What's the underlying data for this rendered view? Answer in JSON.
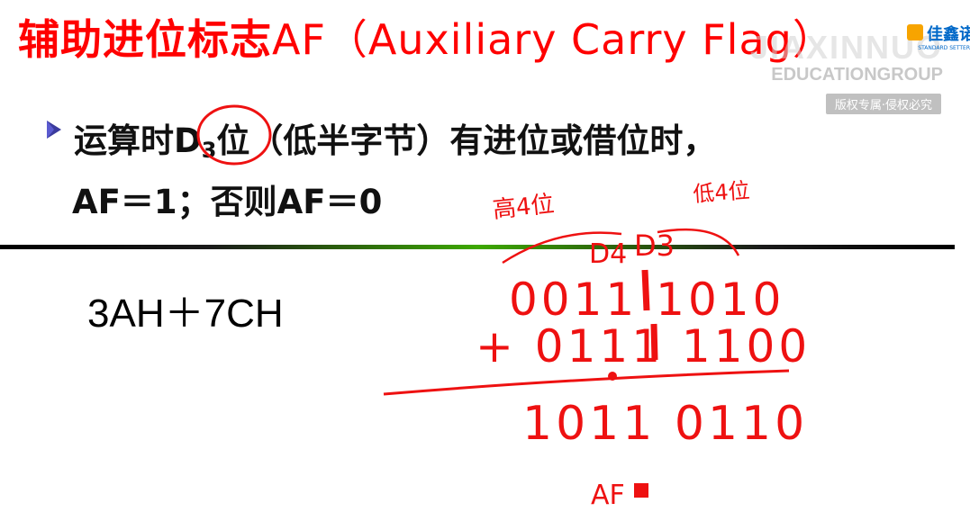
{
  "slide": {
    "title_cn": "辅助进位标志",
    "title_en": "AF（Auxiliary Carry Flag）",
    "watermark": {
      "logo_text": "佳鑫诺",
      "logo_sub": "STANDARD SETTER",
      "line1": "JIAXINNUO",
      "line2": "EDUCATIONGROUP",
      "badge": "版权专属·侵权必究"
    },
    "bullet_icon": "arrow-bullet-icon",
    "rule_line1_prefix": "运算时",
    "rule_line1_d": "D",
    "rule_line1_sub": "3",
    "rule_line1_suffix": "位（低半字节）有进位或借位时，",
    "rule_line2": "AF＝1；否则AF＝0",
    "expression": "3AH＋7CH"
  },
  "colors": {
    "title": "#ff0000",
    "ink": "#ee1111",
    "divider_accent": "#3da800"
  },
  "annotations": {
    "high_label": "高4位",
    "low_label": "低4位",
    "d4": "D4",
    "d3": "D3",
    "row1": "0011 1010",
    "row2": "+ 0111 1100",
    "result": "1011 0110",
    "af": "AF"
  }
}
